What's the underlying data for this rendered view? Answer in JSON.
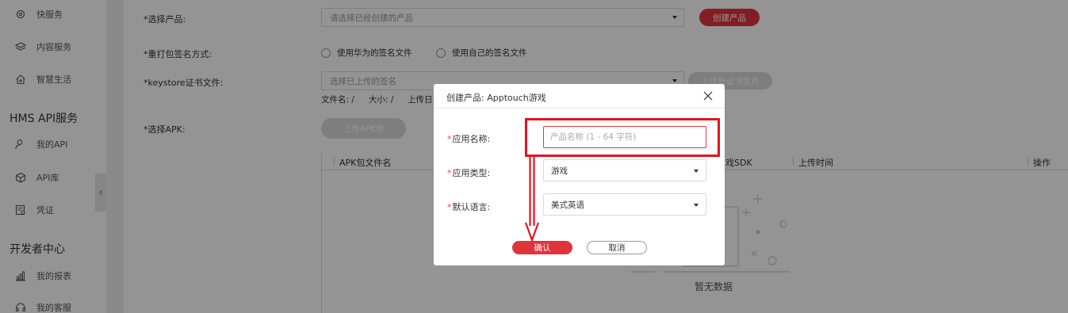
{
  "sidebar": {
    "items": [
      {
        "label": "快服务",
        "icon": "gear-icon"
      },
      {
        "label": "内容服务",
        "icon": "layers-icon"
      },
      {
        "label": "智慧生活",
        "icon": "home-icon"
      },
      {
        "label": "我的API",
        "icon": "user-api-icon"
      },
      {
        "label": "API库",
        "icon": "cube-icon"
      },
      {
        "label": "凭证",
        "icon": "certificate-icon"
      },
      {
        "label": "我的报表",
        "icon": "bar-chart-icon"
      },
      {
        "label": "我的客服",
        "icon": "headset-icon"
      }
    ],
    "sections": [
      "HMS API服务",
      "开发者中心"
    ],
    "collapse_glyph": "‹"
  },
  "form": {
    "select_product_label": "*选择产品:",
    "select_product_placeholder": "请选择已经创建的产品",
    "create_product_button": "创建产品",
    "resign_label": "*重打包签名方式:",
    "radio_huawei": "使用华为的签名文件",
    "radio_own": "使用自己的签名文件",
    "keystore_label": "*keystore证书文件:",
    "keystore_placeholder": "选择已上传的签名",
    "upload_cert_button": "上传新证书文件",
    "file_name": "文件名: /",
    "file_size": "大小: /",
    "upload_date_prefix": "上传日",
    "select_apk_label": "*选择APK:",
    "upload_apk_button": "上传APK包"
  },
  "table": {
    "columns": [
      "APK包文件名",
      "戏SDK",
      "上传时间",
      "操作"
    ],
    "empty_text": "暂无数据"
  },
  "modal": {
    "title": "创建产品: Apptouch游戏",
    "app_name_label": "应用名称:",
    "app_name_placeholder": "产品名称 (1 - 64 字符)",
    "app_type_label": "应用类型:",
    "app_type_value": "游戏",
    "language_label": "默认语言:",
    "language_value": "美式英语",
    "confirm_button": "确认",
    "cancel_button": "取消"
  },
  "colors": {
    "accent": "#e0343d",
    "annotation": "#e8121c"
  }
}
